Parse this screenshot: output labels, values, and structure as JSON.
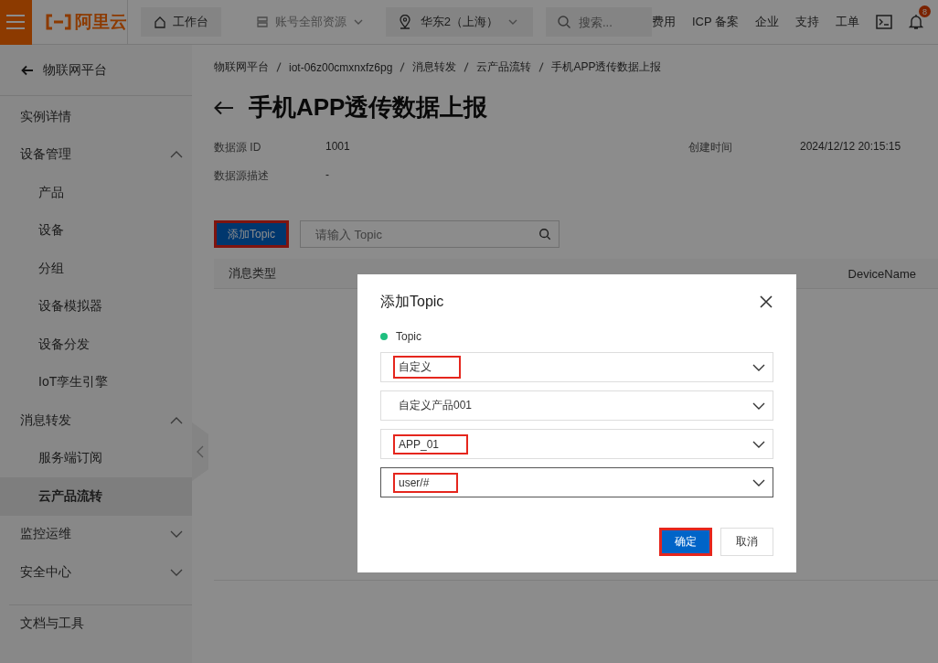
{
  "topbar": {
    "logo": "阿里云",
    "nav": [
      {
        "label": "工作台",
        "kind": "home"
      },
      {
        "label": "账号全部资源",
        "kind": "resource"
      },
      {
        "label": "华东2（上海）",
        "kind": "region"
      }
    ],
    "search": {
      "placeholder": "搜索..."
    },
    "links": [
      "费用",
      "ICP 备案",
      "企业",
      "支持",
      "工单"
    ],
    "notification_count": "8"
  },
  "sidebar": {
    "back_label": "物联网平台",
    "items": [
      {
        "label": "实例详情",
        "selected": false
      },
      {
        "label": "设备管理",
        "selected": false,
        "expanded": true,
        "children": [
          {
            "label": "产品",
            "selected": false
          },
          {
            "label": "设备",
            "selected": false
          },
          {
            "label": "分组",
            "selected": false
          },
          {
            "label": "设备模拟器",
            "selected": false
          },
          {
            "label": "设备分发",
            "selected": false
          },
          {
            "label": "IoT孪生引擎",
            "selected": false
          }
        ]
      },
      {
        "label": "消息转发",
        "selected": false,
        "expanded": true,
        "children": [
          {
            "label": "服务端订阅",
            "selected": false
          },
          {
            "label": "云产品流转",
            "selected": true
          }
        ]
      },
      {
        "label": "监控运维",
        "selected": false,
        "expanded": false
      },
      {
        "label": "安全中心",
        "selected": false,
        "expanded": false
      }
    ],
    "footer_items": [
      {
        "label": "文档与工具",
        "selected": false
      }
    ]
  },
  "page": {
    "breadcrumb": [
      "物联网平台",
      "iot-06z00cmxnxfz6pg",
      "消息转发",
      "云产品流转",
      "手机APP透传数据上报"
    ],
    "title": "手机APP透传数据上报",
    "details": [
      {
        "label": "数据源 ID",
        "value": "1001"
      },
      {
        "label": "创建时间",
        "value": "2024/12/12 20:15:15"
      },
      {
        "label": "数据源描述",
        "value": "-"
      }
    ],
    "add_button": {
      "label": "添加Topic",
      "highlighted": true
    },
    "search": {
      "placeholder": "请输入 Topic"
    },
    "table": {
      "columns": [
        "消息类型",
        "DeviceName"
      ]
    }
  },
  "dialog": {
    "title": "添加Topic",
    "field_label": "Topic",
    "selects": [
      {
        "value": "自定义",
        "highlighted": true,
        "focused": false
      },
      {
        "value": "自定义产品001",
        "highlighted": false,
        "focused": false
      },
      {
        "value": "APP_01",
        "highlighted": true,
        "focused": false
      },
      {
        "value": "user/#",
        "highlighted": true,
        "focused": true
      }
    ],
    "buttons": [
      {
        "label": "确定",
        "kind": "primary",
        "highlighted": true
      },
      {
        "label": "取消",
        "kind": "secondary",
        "highlighted": false
      }
    ]
  }
}
